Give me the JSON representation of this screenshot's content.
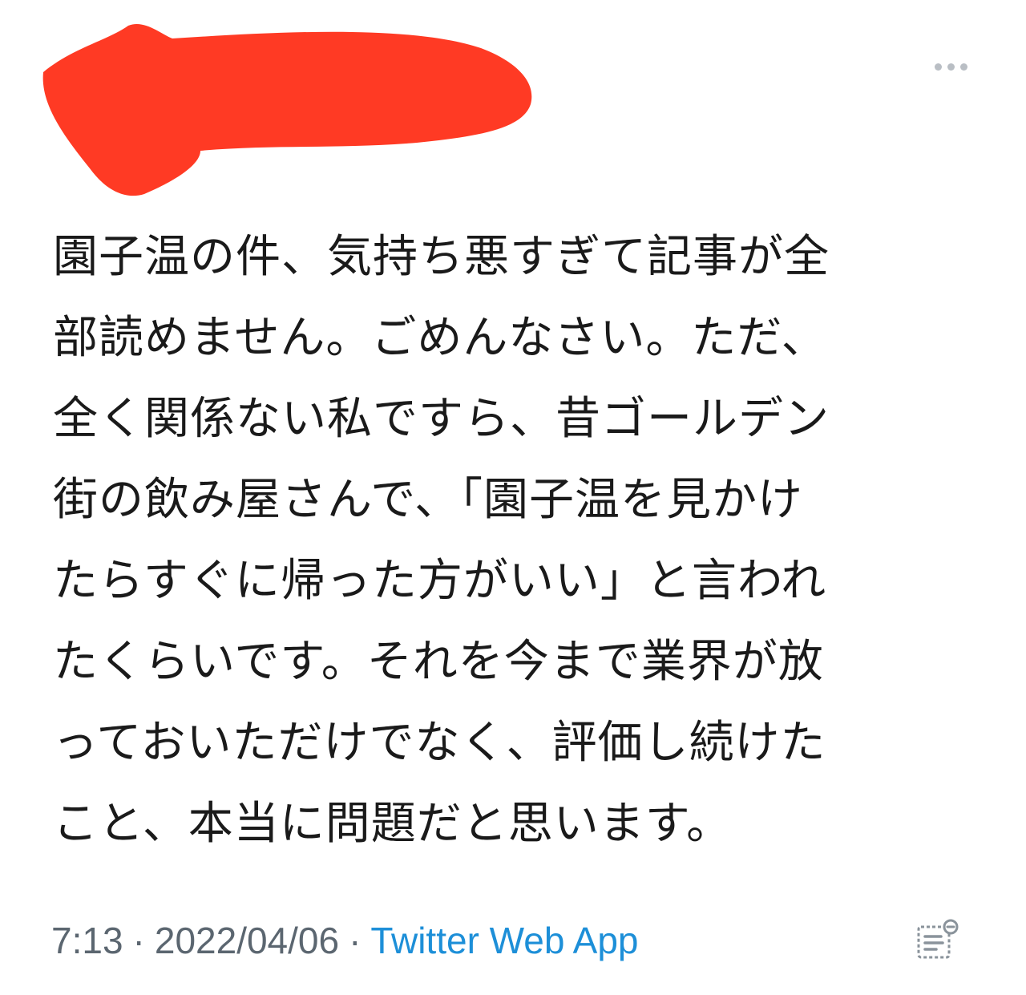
{
  "tweet": {
    "text_lines": [
      "園子温の件、気持ち悪すぎて記事が全",
      "部読めません。ごめんなさい。ただ、",
      "全く関係ない私ですら、昔ゴールデン",
      "街の飲み屋さんで、「園子温を見かけ",
      "たらすぐに帰った方がいい」と言われ",
      "たくらいです。それを今まで業界が放",
      "っておいただけでなく、評価し続けた",
      "こと、本当に問題だと思います。"
    ],
    "time": "7:13",
    "separator": "·",
    "date": "2022/04/06",
    "source": "Twitter Web App"
  },
  "icons": {
    "more": "more-horizontal-icon",
    "analytics": "analytics-icon"
  },
  "colors": {
    "redaction": "#ff3a24",
    "link": "#1d8fd8",
    "meta": "#5b6670",
    "text": "#1a1a1a"
  }
}
